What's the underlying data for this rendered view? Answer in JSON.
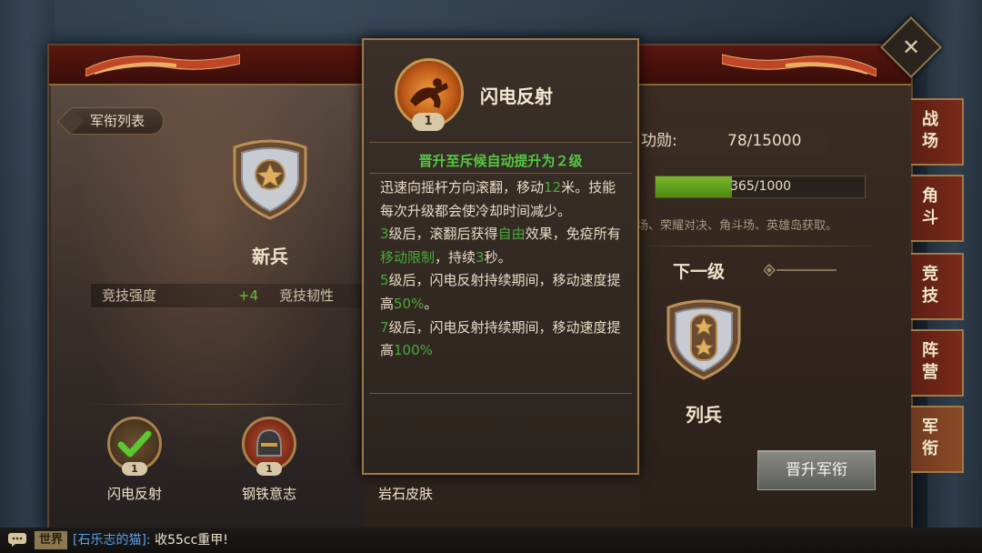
{
  "header": {
    "back_label": "军衔列表"
  },
  "current_rank": {
    "name": "新兵",
    "stars": 1,
    "stat_label_1": "竞技强度",
    "stat_value_1": "+4",
    "stat_label_2": "竞技韧性"
  },
  "skills": [
    {
      "name": "闪电反射",
      "level": "1",
      "icon": "check-icon"
    },
    {
      "name": "钢铁意志",
      "level": "1",
      "icon": "helmet-icon"
    },
    {
      "name": "岩石皮肤",
      "level": "",
      "icon": ""
    }
  ],
  "merit": {
    "label": "功勋:",
    "value": "78/15000"
  },
  "progress": {
    "text": "365/1000",
    "fraction": 0.365
  },
  "source_text": "场、荣耀对决、角斗场、英雄岛获取。",
  "next": {
    "label": "下一级",
    "rank_name": "列兵",
    "stars": 2
  },
  "promote_button": "晋升军衔",
  "tabs": [
    {
      "label": "战场",
      "chars": [
        "战",
        "场"
      ]
    },
    {
      "label": "角斗",
      "chars": [
        "角",
        "斗"
      ]
    },
    {
      "label": "竞技",
      "chars": [
        "竞",
        "技"
      ]
    },
    {
      "label": "阵营",
      "chars": [
        "阵",
        "营"
      ]
    },
    {
      "label": "军衔",
      "chars": [
        "军",
        "衔"
      ],
      "active": true
    }
  ],
  "tooltip": {
    "title": "闪电反射",
    "level": "1",
    "promo": "晋升至斥候自动提升为２级",
    "desc": {
      "p1_a": "迅速向摇杆方向滚翻，移动",
      "p1_b": "12",
      "p1_c": "米。技能每次升级都会使冷却时间减少。",
      "p2_a": "3",
      "p2_b": "级后，滚翻后获得",
      "p2_c": "自由",
      "p2_d": "效果，免疫所有",
      "p2_e": "移动限制",
      "p2_f": "，持续",
      "p2_g": "3",
      "p2_h": "秒。",
      "p3_a": "5",
      "p3_b": "级后，闪电反射持续期间，移动速度提高",
      "p3_c": "50%",
      "p3_d": "。",
      "p4_a": "7",
      "p4_b": "级后，闪电反射持续期间，移动速度提高",
      "p4_c": "100%"
    }
  },
  "chat": {
    "channel": "世界",
    "user": "[石乐志的猫]:",
    "message": "收55cc重甲!"
  },
  "colors": {
    "accent_green": "#52c843",
    "gold_border": "#9a7a4c",
    "tab_red": "#7a2a1a"
  }
}
